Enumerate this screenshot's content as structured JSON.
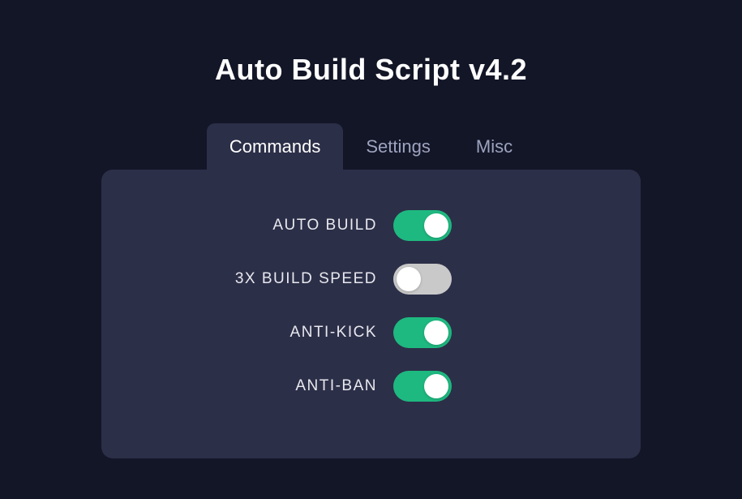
{
  "title": "Auto Build Script v4.2",
  "tabs": [
    {
      "id": "commands",
      "label": "Commands",
      "active": true
    },
    {
      "id": "settings",
      "label": "Settings",
      "active": false
    },
    {
      "id": "misc",
      "label": "Misc",
      "active": false
    }
  ],
  "options": [
    {
      "id": "auto-build",
      "label": "AUTO BUILD",
      "enabled": true
    },
    {
      "id": "build-speed",
      "label": "3X BUILD SPEED",
      "enabled": false
    },
    {
      "id": "anti-kick",
      "label": "ANTI-KICK",
      "enabled": true
    },
    {
      "id": "anti-ban",
      "label": "ANTI-BAN",
      "enabled": true
    }
  ],
  "colors": {
    "background": "#131627",
    "panel": "#2c2f48",
    "toggle_on": "#1eb980",
    "toggle_off": "#c9c9c9",
    "text_primary": "#ffffff",
    "text_secondary": "#9ea3bf"
  }
}
